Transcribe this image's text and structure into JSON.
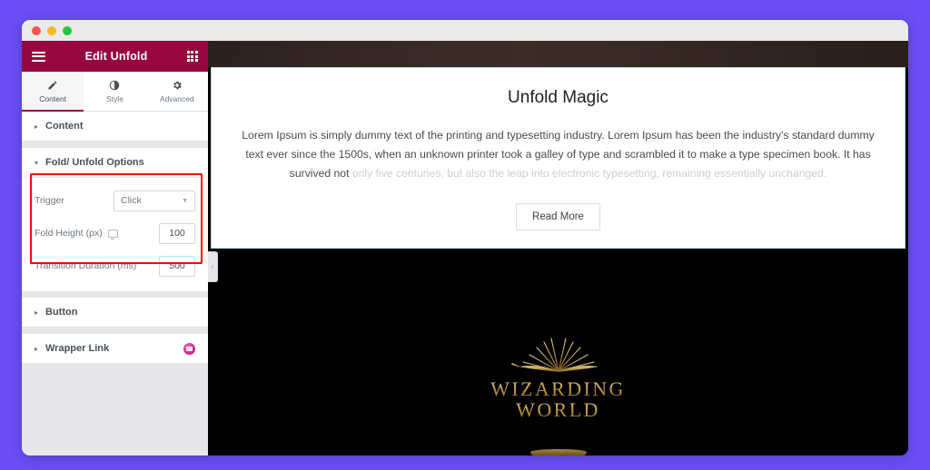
{
  "window": {
    "traffic_lights": [
      "close",
      "minimize",
      "maximize"
    ]
  },
  "panel": {
    "header": {
      "title": "Edit Unfold",
      "menu_icon": "hamburger-icon",
      "apps_icon": "grid-icon"
    },
    "tabs": [
      {
        "label": "Content",
        "icon": "pencil-icon",
        "active": true
      },
      {
        "label": "Style",
        "icon": "contrast-icon",
        "active": false
      },
      {
        "label": "Advanced",
        "icon": "gear-icon",
        "active": false
      }
    ],
    "sections": [
      {
        "label": "Content",
        "expanded": false,
        "chevron": "▸"
      },
      {
        "label": "Fold/ Unfold Options",
        "expanded": true,
        "chevron": "▾"
      },
      {
        "label": "Button",
        "expanded": false,
        "chevron": "▸"
      },
      {
        "label": "Wrapper Link",
        "expanded": false,
        "chevron": "▸",
        "badge": "pro-badge-icon"
      }
    ],
    "controls": {
      "trigger": {
        "label": "Trigger",
        "value": "Click",
        "caret": "▼"
      },
      "fold_height": {
        "label": "Fold Height (px)",
        "value": "100",
        "device_icon": "desktop-monitor-icon"
      },
      "transition_duration": {
        "label": "Transition Duration (ms)",
        "value": "500"
      }
    },
    "collapse_chevron": "‹",
    "highlight_color": "#fe0000"
  },
  "preview": {
    "card": {
      "title": "Unfold Magic",
      "body_visible": "Lorem Ipsum is simply dummy text of the printing and typesetting industry. Lorem Ipsum has been the industry's standard dummy text ever since the 1500s, when an unknown printer took a galley of type and scrambled it to make a type specimen book. It has survived not ",
      "body_faded": "only five centuries, but also the leap into electronic typesetting, remaining essentially unchanged.",
      "button_label": "Read More"
    },
    "logo": {
      "line1": "WIZARDING",
      "line2": "WORLD",
      "icon": "wand-rays-book-icon"
    }
  },
  "colors": {
    "page_background": "#6b4ef5",
    "panel_header": "#96063f",
    "panel_background": "#e7e7ea",
    "accent_underline": "#96063f",
    "card_border": "#bfe2f5",
    "logo_gold": "#c9a24a"
  }
}
